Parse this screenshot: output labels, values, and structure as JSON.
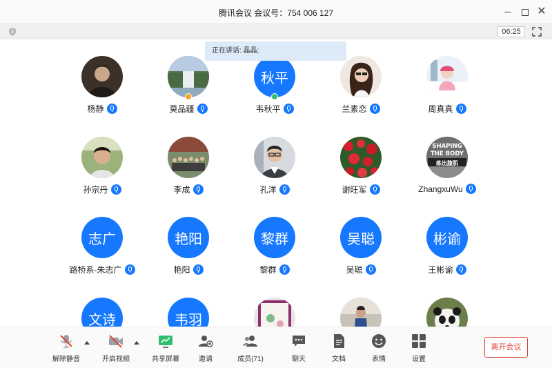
{
  "window": {
    "title": "腾讯会议 会议号：754 006 127",
    "minimize_icon": "minimize-icon",
    "maximize_icon": "maximize-icon",
    "close_icon": "close-icon"
  },
  "subbar": {
    "timer": "06:25",
    "security_icon": "shield-icon",
    "fullscreen_icon": "fullscreen-icon"
  },
  "speaking": {
    "label": "正在讲话: 晶晶;"
  },
  "participants": [
    {
      "name": "杨静",
      "avatar_text": "",
      "photo": "portrait-dark"
    },
    {
      "name": "莫品疆",
      "avatar_text": "",
      "photo": "waterfall",
      "badge": "host"
    },
    {
      "name": "韦秋平",
      "avatar_text": "秋平",
      "badge": "cohost"
    },
    {
      "name": "兰素恋",
      "avatar_text": "",
      "photo": "woman-sunglasses"
    },
    {
      "name": "周真真",
      "avatar_text": "",
      "photo": "baby-snow"
    },
    {
      "name": "孙宗丹",
      "avatar_text": "",
      "photo": "young-man"
    },
    {
      "name": "李成",
      "avatar_text": "",
      "photo": "group-photo"
    },
    {
      "name": "孔洋",
      "avatar_text": "",
      "photo": "man-glasses"
    },
    {
      "name": "谢旺军",
      "avatar_text": "",
      "photo": "red-flowers"
    },
    {
      "name": "ZhangxuWu",
      "avatar_text": "",
      "photo": "book-cover",
      "photo_text": [
        "SHAPING",
        "THE BODY",
        "练出腹肌"
      ]
    },
    {
      "name": "路桥系-朱志广",
      "avatar_text": "志广"
    },
    {
      "name": "艳阳",
      "avatar_text": "艳阳"
    },
    {
      "name": "黎群",
      "avatar_text": "黎群"
    },
    {
      "name": "吴聪",
      "avatar_text": "吴聪"
    },
    {
      "name": "王彬谕",
      "avatar_text": "彬谕"
    },
    {
      "name": "",
      "avatar_text": "文诗"
    },
    {
      "name": "",
      "avatar_text": "韦羽"
    },
    {
      "name": "",
      "avatar_text": "",
      "photo": "pink-card"
    },
    {
      "name": "",
      "avatar_text": "",
      "photo": "street-woman"
    },
    {
      "name": "",
      "avatar_text": "",
      "photo": "panda"
    }
  ],
  "toolbar": {
    "unmute": "解除静音",
    "start_video": "开启视频",
    "share_screen": "共享屏幕",
    "invite": "邀请",
    "members": "成员(71)",
    "chat": "聊天",
    "docs": "文档",
    "reactions": "表情",
    "settings": "设置",
    "leave": "离开会议"
  },
  "colors": {
    "accent": "#1678ff",
    "leave": "#e0453a",
    "speaking_bg": "#ddeaf8"
  }
}
